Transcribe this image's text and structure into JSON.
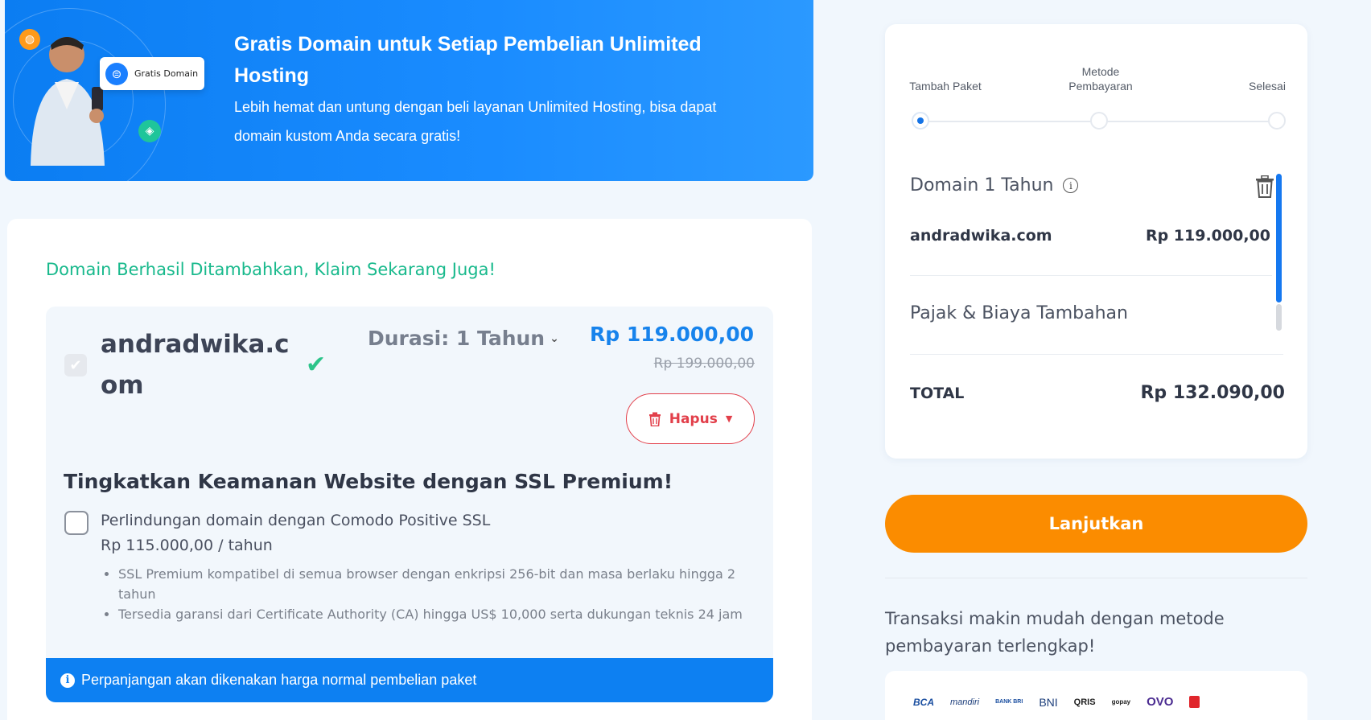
{
  "banner": {
    "title": "Gratis Domain untuk Setiap Pembelian Unlimited Hosting",
    "description": "Lebih hemat dan untung dengan beli layanan Unlimited Hosting, bisa dapat domain kustom Anda secara gratis!",
    "badge_label": "Gratis Domain"
  },
  "main": {
    "success_text": "Domain Berhasil Ditambahkan, Klaim Sekarang Juga!",
    "domain_name": "andradwika.com",
    "duration_label": "Durasi: 1 Tahun",
    "price_now": "Rp 119.000,00",
    "price_old": "Rp 199.000,00",
    "delete_label": "Hapus",
    "ssl_title": "Tingkatkan Keamanan Website dengan SSL Premium!",
    "ssl_option_label": "Perlindungan domain dengan Comodo Positive SSL",
    "ssl_option_price": "Rp 115.000,00 / tahun",
    "ssl_bullets": [
      "SSL Premium kompatibel di semua browser dengan enkripsi 256-bit dan masa berlaku hingga 2 tahun",
      "Tersedia garansi dari Certificate Authority (CA) hingga US$ 10,000 serta dukungan teknis 24 jam"
    ],
    "note": "Perpanjangan akan dikenakan harga normal pembelian paket"
  },
  "summary": {
    "steps": [
      "Tambah Paket",
      "Metode Pembayaran",
      "Selesai"
    ],
    "active_step": 0,
    "item_title": "Domain 1 Tahun",
    "item_name": "andradwika.com",
    "item_price": "Rp 119.000,00",
    "tax_label": "Pajak & Biaya Tambahan",
    "total_label": "TOTAL",
    "total_value": "Rp 132.090,00",
    "continue_label": "Lanjutkan"
  },
  "payment": {
    "text": "Transaksi makin mudah dengan metode pembayaran terlengkap!",
    "logos": [
      "BCA",
      "mandiri",
      "BANK BRI",
      "BNI",
      "QRIS",
      "gopay",
      "OVO"
    ]
  },
  "colors": {
    "primary_blue": "#0d80f2",
    "success_green": "#18b98c",
    "danger_red": "#e23f4a",
    "cta_orange": "#fb8c00"
  }
}
